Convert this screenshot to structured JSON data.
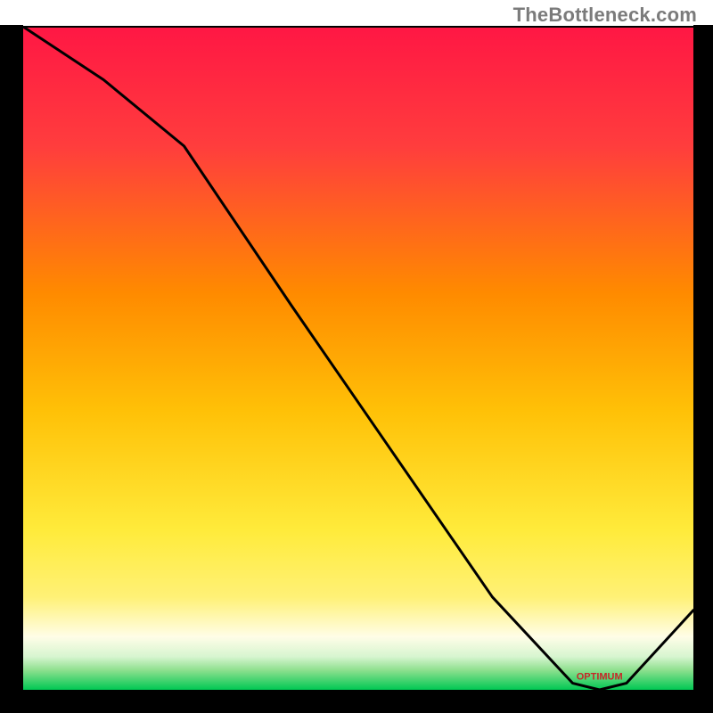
{
  "watermark": "TheBottleneck.com",
  "chart_data": {
    "type": "line",
    "title": "",
    "xlabel": "",
    "ylabel": "",
    "xlim": [
      0,
      100
    ],
    "ylim": [
      0,
      100
    ],
    "note": "Axis values are not labeled in the image; x/y expressed as 0–100 percent of plot area. The curve starts at top-left, descends with a knee around x≈25, reaches ~0 around x≈82–90 (flat minimum), then rises toward the right edge.",
    "series": [
      {
        "name": "bottleneck-curve",
        "x": [
          0,
          12,
          24,
          40,
          55,
          70,
          82,
          86,
          90,
          100
        ],
        "y": [
          100,
          92,
          82,
          58,
          36,
          14,
          1,
          0,
          1,
          12
        ]
      }
    ],
    "annotations": [
      {
        "name": "min-label",
        "text": "OPTIMUM",
        "x": 86,
        "y": 1
      }
    ],
    "background_bands": [
      {
        "from_y": 100,
        "to_y": 12,
        "gradient": [
          "#ff1744",
          "#ffee58"
        ]
      },
      {
        "from_y": 12,
        "to_y": 3,
        "gradient": [
          "#fff59d",
          "#fffde7"
        ]
      },
      {
        "from_y": 3,
        "to_y": 0,
        "gradient": [
          "#a8e6a3",
          "#00c853"
        ]
      }
    ]
  },
  "frame_color": "#000000"
}
